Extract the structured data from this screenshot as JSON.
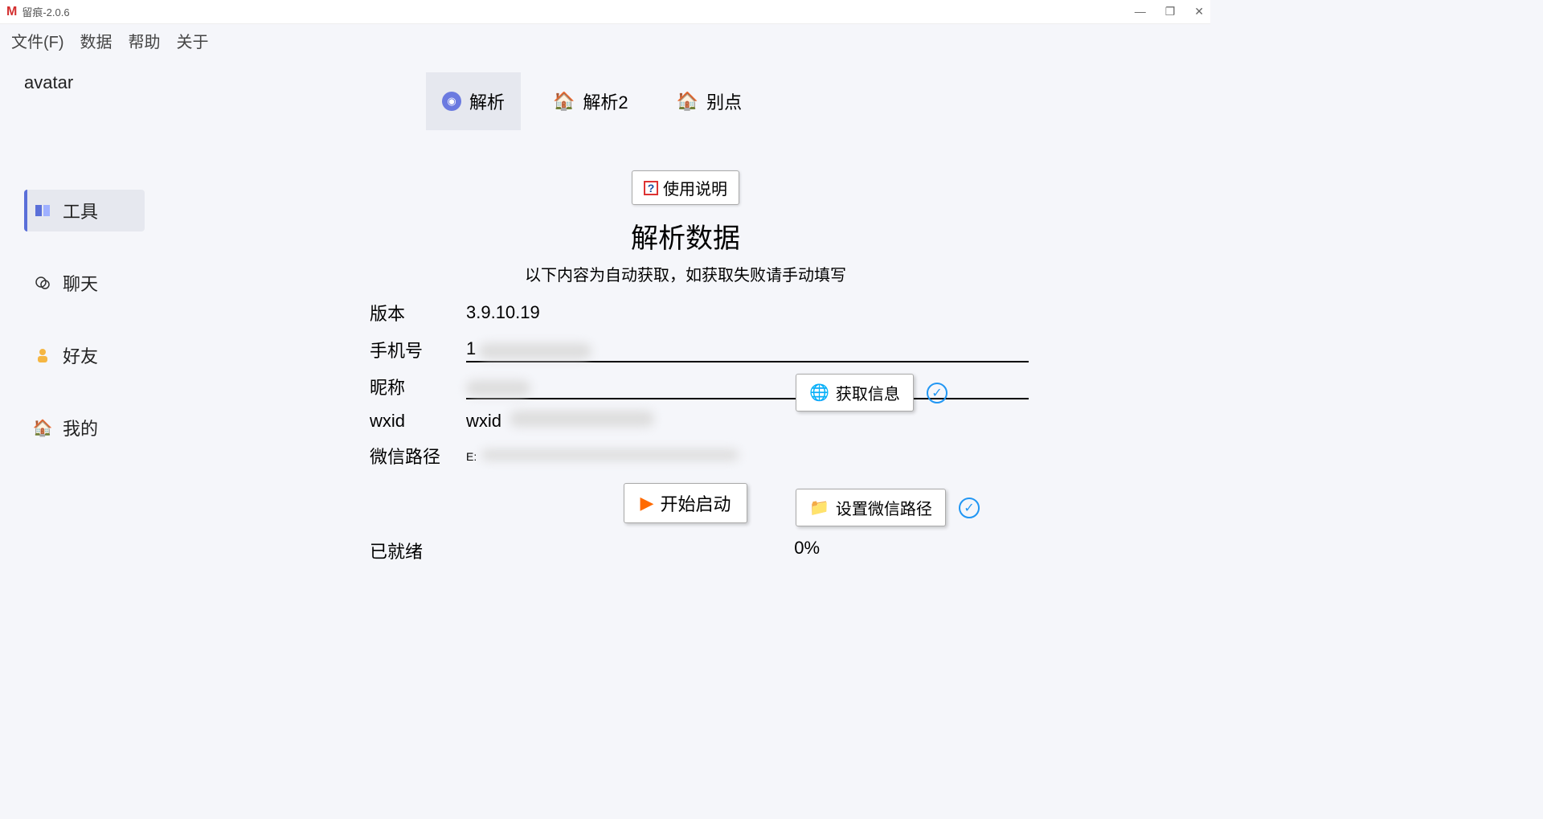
{
  "window": {
    "title": "留痕-2.0.6"
  },
  "menu": {
    "file": "文件(F)",
    "data": "数据",
    "help": "帮助",
    "about": "关于"
  },
  "sidebar": {
    "avatar": "avatar",
    "items": [
      {
        "label": "工具"
      },
      {
        "label": "聊天"
      },
      {
        "label": "好友"
      },
      {
        "label": "我的"
      }
    ]
  },
  "tabs": [
    {
      "label": "解析"
    },
    {
      "label": "解析2"
    },
    {
      "label": "别点"
    }
  ],
  "help_button": "使用说明",
  "title": "解析数据",
  "subtitle": "以下内容为自动获取，如获取失败请手动填写",
  "form": {
    "version_label": "版本",
    "version_value": "3.9.10.19",
    "phone_label": "手机号",
    "phone_value": "1",
    "nick_label": "昵称",
    "nick_value": "",
    "wxid_label": "wxid",
    "wxid_value": "wxid",
    "path_label": "微信路径",
    "path_value": "E:"
  },
  "buttons": {
    "get_info": "获取信息",
    "set_path": "设置微信路径",
    "start": "开始启动"
  },
  "status": {
    "ready": "已就绪",
    "progress": "0%"
  }
}
